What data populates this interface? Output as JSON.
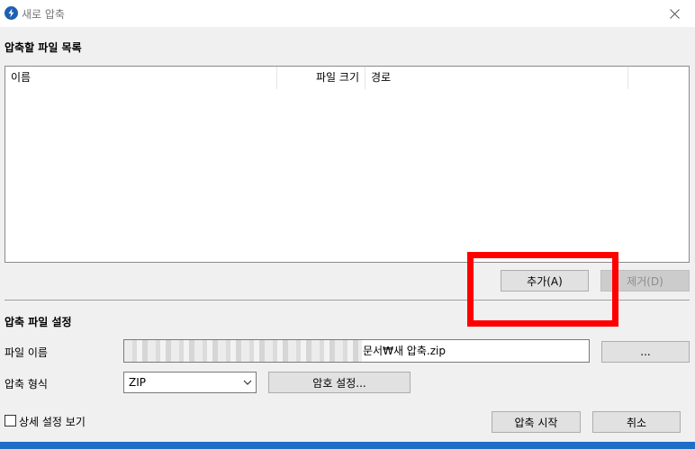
{
  "window": {
    "title": "새로 압축",
    "icon": "app-lightning-icon",
    "close_icon": "close-icon"
  },
  "filelist_section": {
    "label": "압축할 파일 목록",
    "columns": [
      "이름",
      "파일 크기",
      "경로"
    ],
    "rows": []
  },
  "filelist_buttons": {
    "add": "추가(A)",
    "remove": "제거(D)"
  },
  "settings_section": {
    "label": "압축 파일 설정",
    "filename_label": "파일 이름",
    "filename_value": "문서₩새 압축.zip",
    "browse_label": "...",
    "format_label": "압축 형식",
    "format_value": "ZIP",
    "password_button": "암호 설정..."
  },
  "footer": {
    "details_checkbox_label": "상세 설정 보기",
    "details_checked": false,
    "start_button": "압축 시작",
    "cancel_button": "취소"
  },
  "colors": {
    "annotation": "#ff0000",
    "accent": "#1c6ec7"
  }
}
